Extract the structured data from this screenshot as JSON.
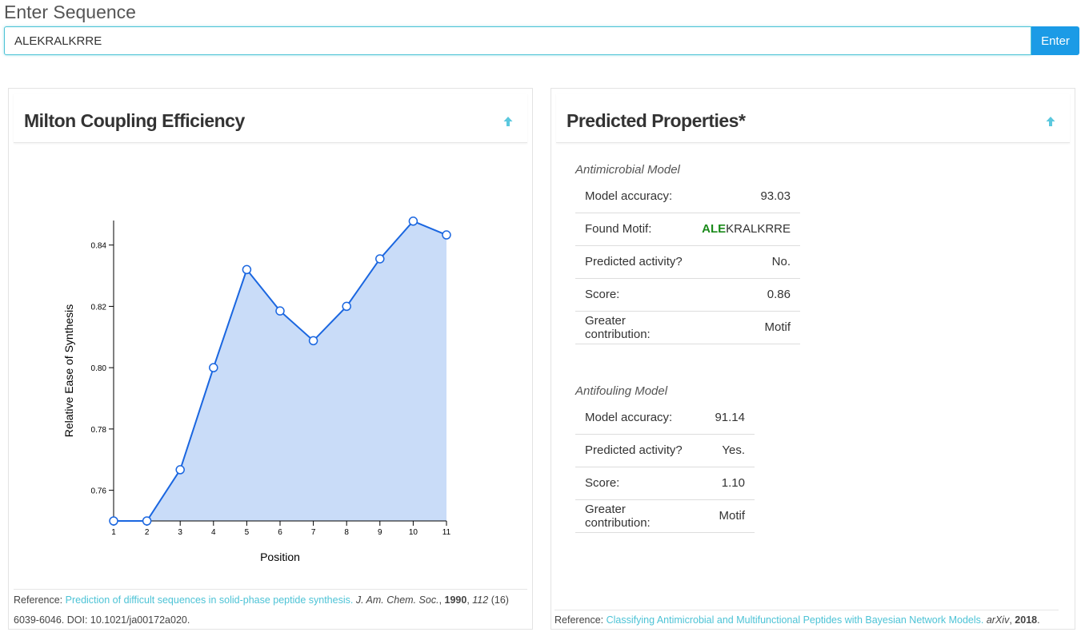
{
  "sequence": {
    "title": "Enter Sequence",
    "value": "ALEKRALKRRE",
    "button_label": "Enter"
  },
  "coupling_panel": {
    "title": "Milton Coupling Efficiency",
    "collapse_icon": "arrow-up-icon",
    "reference": {
      "prefix": "Reference: ",
      "link_text": "Prediction of difficult sequences in solid-phase peptide synthesis.",
      "journal": "J. Am. Chem. Soc.",
      "year": "1990",
      "volume": "112",
      "issue": "(16)",
      "pages_doi": "6039-6046. DOI: 10.1021/ja00172a020."
    }
  },
  "chart_data": {
    "type": "area",
    "xlabel": "Position",
    "ylabel": "Relative Ease of Synthesis",
    "x": [
      1,
      2,
      3,
      4,
      5,
      6,
      7,
      8,
      9,
      10,
      11
    ],
    "values": [
      0.75,
      0.75,
      0.7667,
      0.8,
      0.832,
      0.8185,
      0.8088,
      0.82,
      0.8355,
      0.8478,
      0.8433
    ],
    "yticks": [
      "0.76",
      "0.78",
      "0.80",
      "0.82",
      "0.84"
    ],
    "ylim": [
      0.75,
      0.848
    ],
    "xlim": [
      1,
      11
    ],
    "line_color": "#1a66e0",
    "fill_color": "#c9dcf8",
    "grid": false
  },
  "properties_panel": {
    "title": "Predicted Properties*",
    "collapse_icon": "arrow-up-icon",
    "antimicrobial": {
      "title": "Antimicrobial Model",
      "rows": [
        {
          "label": "Model accuracy:",
          "value": "93.03"
        },
        {
          "label": "Found Motif:",
          "value": "ALEKRALKRRE"
        },
        {
          "label": "Predicted activity?",
          "value": "No."
        },
        {
          "label": "Score:",
          "value": "0.86"
        },
        {
          "label": "Greater contribution:",
          "value": "Motif"
        }
      ],
      "motif_highlight": "ALE",
      "motif_rest": "KRALKRRE",
      "motif_color": "#1a8a1a"
    },
    "antifouling": {
      "title": "Antifouling Model",
      "rows": [
        {
          "label": "Model accuracy:",
          "value": "91.14"
        },
        {
          "label": "Predicted activity?",
          "value": "Yes."
        },
        {
          "label": "Score:",
          "value": "1.10"
        },
        {
          "label": "Greater contribution:",
          "value": "Motif"
        }
      ]
    },
    "reference": {
      "prefix": "Reference: ",
      "link_text": "Classifying Antimicrobial and Multifunctional Peptides with Bayesian Network Models.",
      "journal": "arXiv",
      "year": "2018"
    }
  },
  "colors": {
    "accent": "#4dc3d6",
    "button": "#1b9be6"
  }
}
